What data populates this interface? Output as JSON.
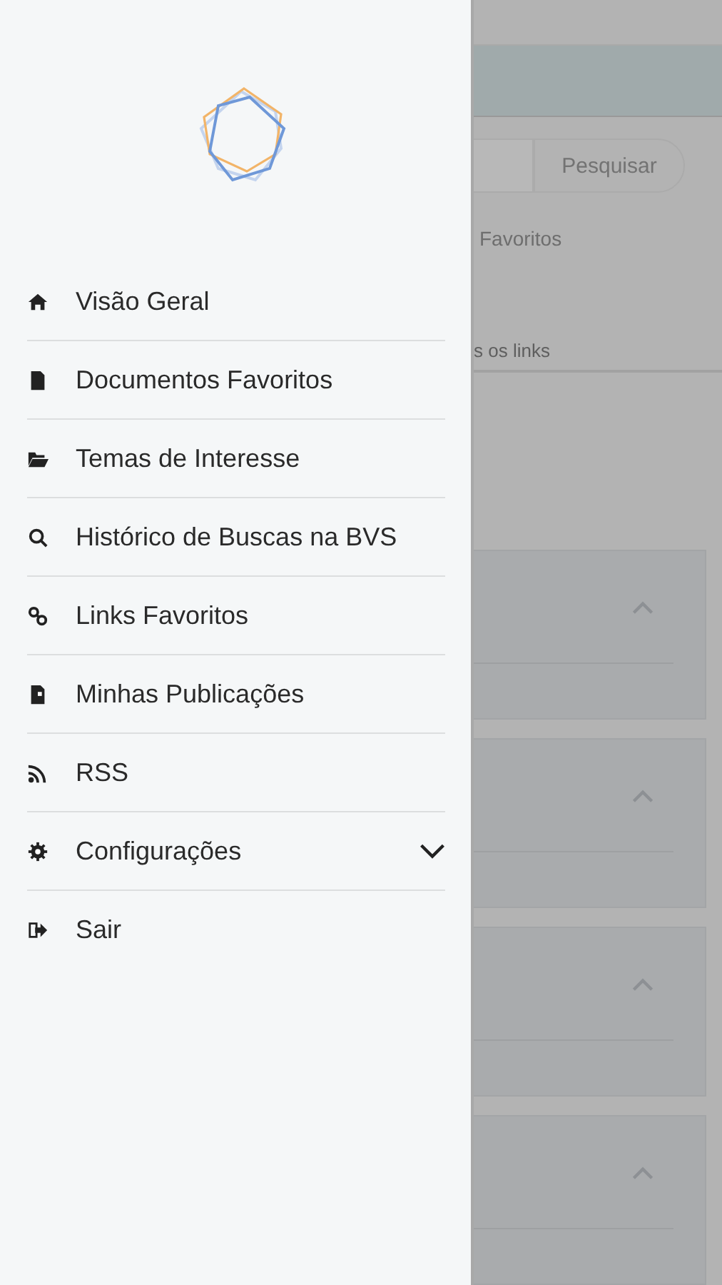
{
  "drawer": {
    "menu": [
      {
        "label": "Visão Geral",
        "kind": "link"
      },
      {
        "label": "Documentos Favoritos",
        "kind": "link"
      },
      {
        "label": "Temas de Interesse",
        "kind": "link"
      },
      {
        "label": "Histórico de Buscas na BVS",
        "kind": "link"
      },
      {
        "label": "Links Favoritos",
        "kind": "link"
      },
      {
        "label": "Minhas Publicações",
        "kind": "link"
      },
      {
        "label": "RSS",
        "kind": "link"
      },
      {
        "label": "Configurações",
        "kind": "group",
        "expanded": false
      },
      {
        "label": "Sair",
        "kind": "link"
      }
    ]
  },
  "background_page": {
    "search_button": "Pesquisar",
    "label": "Favoritos",
    "tab": "s os links",
    "cards": [
      {
        "expanded": true
      },
      {
        "expanded": true
      },
      {
        "expanded": true
      },
      {
        "expanded": true
      }
    ]
  }
}
